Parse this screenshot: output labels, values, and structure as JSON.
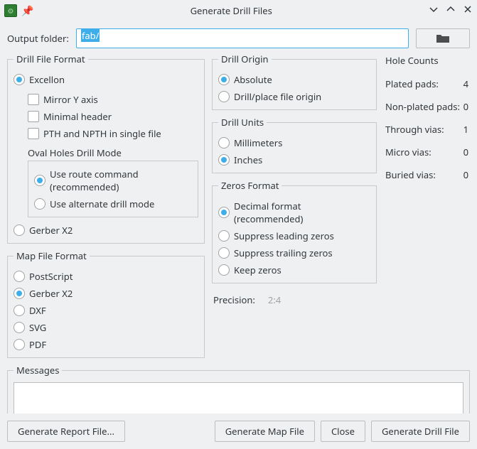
{
  "title": "Generate Drill Files",
  "output": {
    "label": "Output folder:",
    "value": "fab/"
  },
  "drill_file_format": {
    "legend": "Drill File Format",
    "excellon": "Excellon",
    "mirror_y": "Mirror Y axis",
    "minimal_header": "Minimal header",
    "pth_npth_single": "PTH and NPTH in single file",
    "oval_mode_label": "Oval Holes Drill Mode",
    "route_cmd": "Use route command (recommended)",
    "alt_drill": "Use alternate drill mode",
    "gerber_x2": "Gerber X2"
  },
  "map_file_format": {
    "legend": "Map File Format",
    "postscript": "PostScript",
    "gerber_x2": "Gerber X2",
    "dxf": "DXF",
    "svg": "SVG",
    "pdf": "PDF"
  },
  "drill_origin": {
    "legend": "Drill Origin",
    "absolute": "Absolute",
    "drill_place": "Drill/place file origin"
  },
  "drill_units": {
    "legend": "Drill Units",
    "mm": "Millimeters",
    "inches": "Inches"
  },
  "zeros_format": {
    "legend": "Zeros Format",
    "decimal": "Decimal format (recommended)",
    "sup_leading": "Suppress leading zeros",
    "sup_trailing": "Suppress trailing zeros",
    "keep": "Keep zeros"
  },
  "precision": {
    "label": "Precision:",
    "value": "2:4"
  },
  "hole_counts": {
    "legend": "Hole Counts",
    "plated_label": "Plated pads:",
    "plated_val": "4",
    "nonplated_label": "Non-plated pads:",
    "nonplated_val": "0",
    "through_label": "Through vias:",
    "through_val": "1",
    "micro_label": "Micro vias:",
    "micro_val": "0",
    "buried_label": "Buried vias:",
    "buried_val": "0"
  },
  "messages": {
    "legend": "Messages"
  },
  "buttons": {
    "report": "Generate Report File...",
    "map": "Generate Map File",
    "close": "Close",
    "drill": "Generate Drill File"
  }
}
